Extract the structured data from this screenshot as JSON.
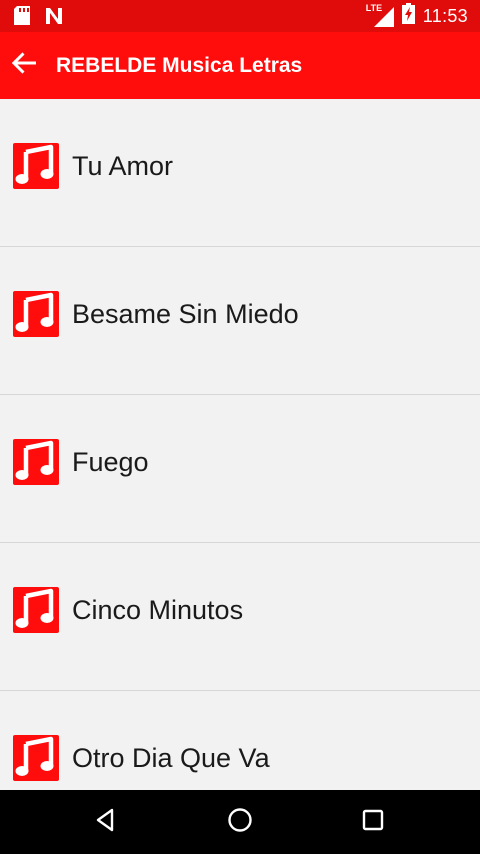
{
  "status_bar": {
    "time": "11:53",
    "network_label": "LTE",
    "icons": [
      "sd-card-icon",
      "n-notification-icon",
      "signal-icon",
      "battery-charging-icon"
    ]
  },
  "app_bar": {
    "title": "REBELDE Musica Letras",
    "back_icon": "arrow-back-icon",
    "color": "#ff0d0d"
  },
  "songs": [
    {
      "title": "Tu Amor",
      "icon": "music-note-icon"
    },
    {
      "title": "Besame Sin Miedo",
      "icon": "music-note-icon"
    },
    {
      "title": "Fuego",
      "icon": "music-note-icon"
    },
    {
      "title": "Cinco Minutos",
      "icon": "music-note-icon"
    },
    {
      "title": "Otro Dia Que Va",
      "icon": "music-note-icon"
    }
  ],
  "nav_bar": {
    "icons": [
      "back-triangle-icon",
      "home-circle-icon",
      "recents-square-icon"
    ]
  },
  "colors": {
    "accent": "#ff0d0d",
    "status_bar": "#e00b0b",
    "background": "#f2f2f2",
    "divider": "#d6d6d6"
  }
}
